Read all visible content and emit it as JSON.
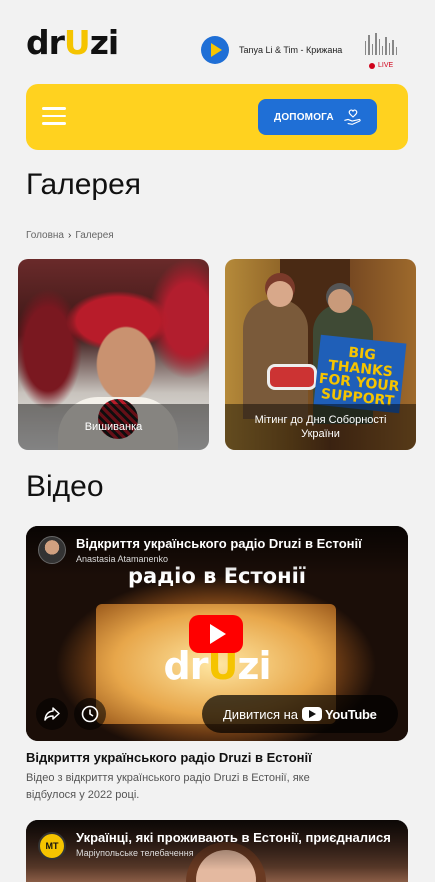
{
  "header": {
    "logo_text_before": "dr",
    "logo_text_u": "U",
    "logo_text_after": "zi",
    "now_playing": "Tanya Li & Tim - Крижана",
    "live_label": "LIVE",
    "help_button": "ДОПОМОГА",
    "colors": {
      "brand_blue": "#1f6fd6",
      "brand_yellow": "#ffd21f",
      "live_red": "#d0021b"
    }
  },
  "page": {
    "title": "Галерея",
    "breadcrumb": {
      "home": "Головна",
      "separator": "›",
      "current": "Галерея"
    }
  },
  "gallery": [
    {
      "caption": "Вишиванка"
    },
    {
      "caption": "Мітинг до Дня Соборності України",
      "sign_text": "BIG THANKS FOR YOUR SUPPORT"
    }
  ],
  "videos_section": {
    "title": "Відео"
  },
  "videos": [
    {
      "embed_title": "Відкриття українського радіо Druzi в Естонії",
      "channel": "Anastasia Atamanenko",
      "overlay_line": "радіо в Естонії",
      "watch_on": "Дивитися на",
      "youtube": "YouTube",
      "title": "Відкриття українського радіо Druzi в Естонії",
      "description": "Відео з відкриття українського радіо Druzi в Естонії, яке відбулося у 2022 році."
    },
    {
      "embed_title": "Українці, які проживають в Естонії, приєдналися",
      "channel": "Маріупольське телебачення",
      "logo": "МТ"
    }
  ]
}
